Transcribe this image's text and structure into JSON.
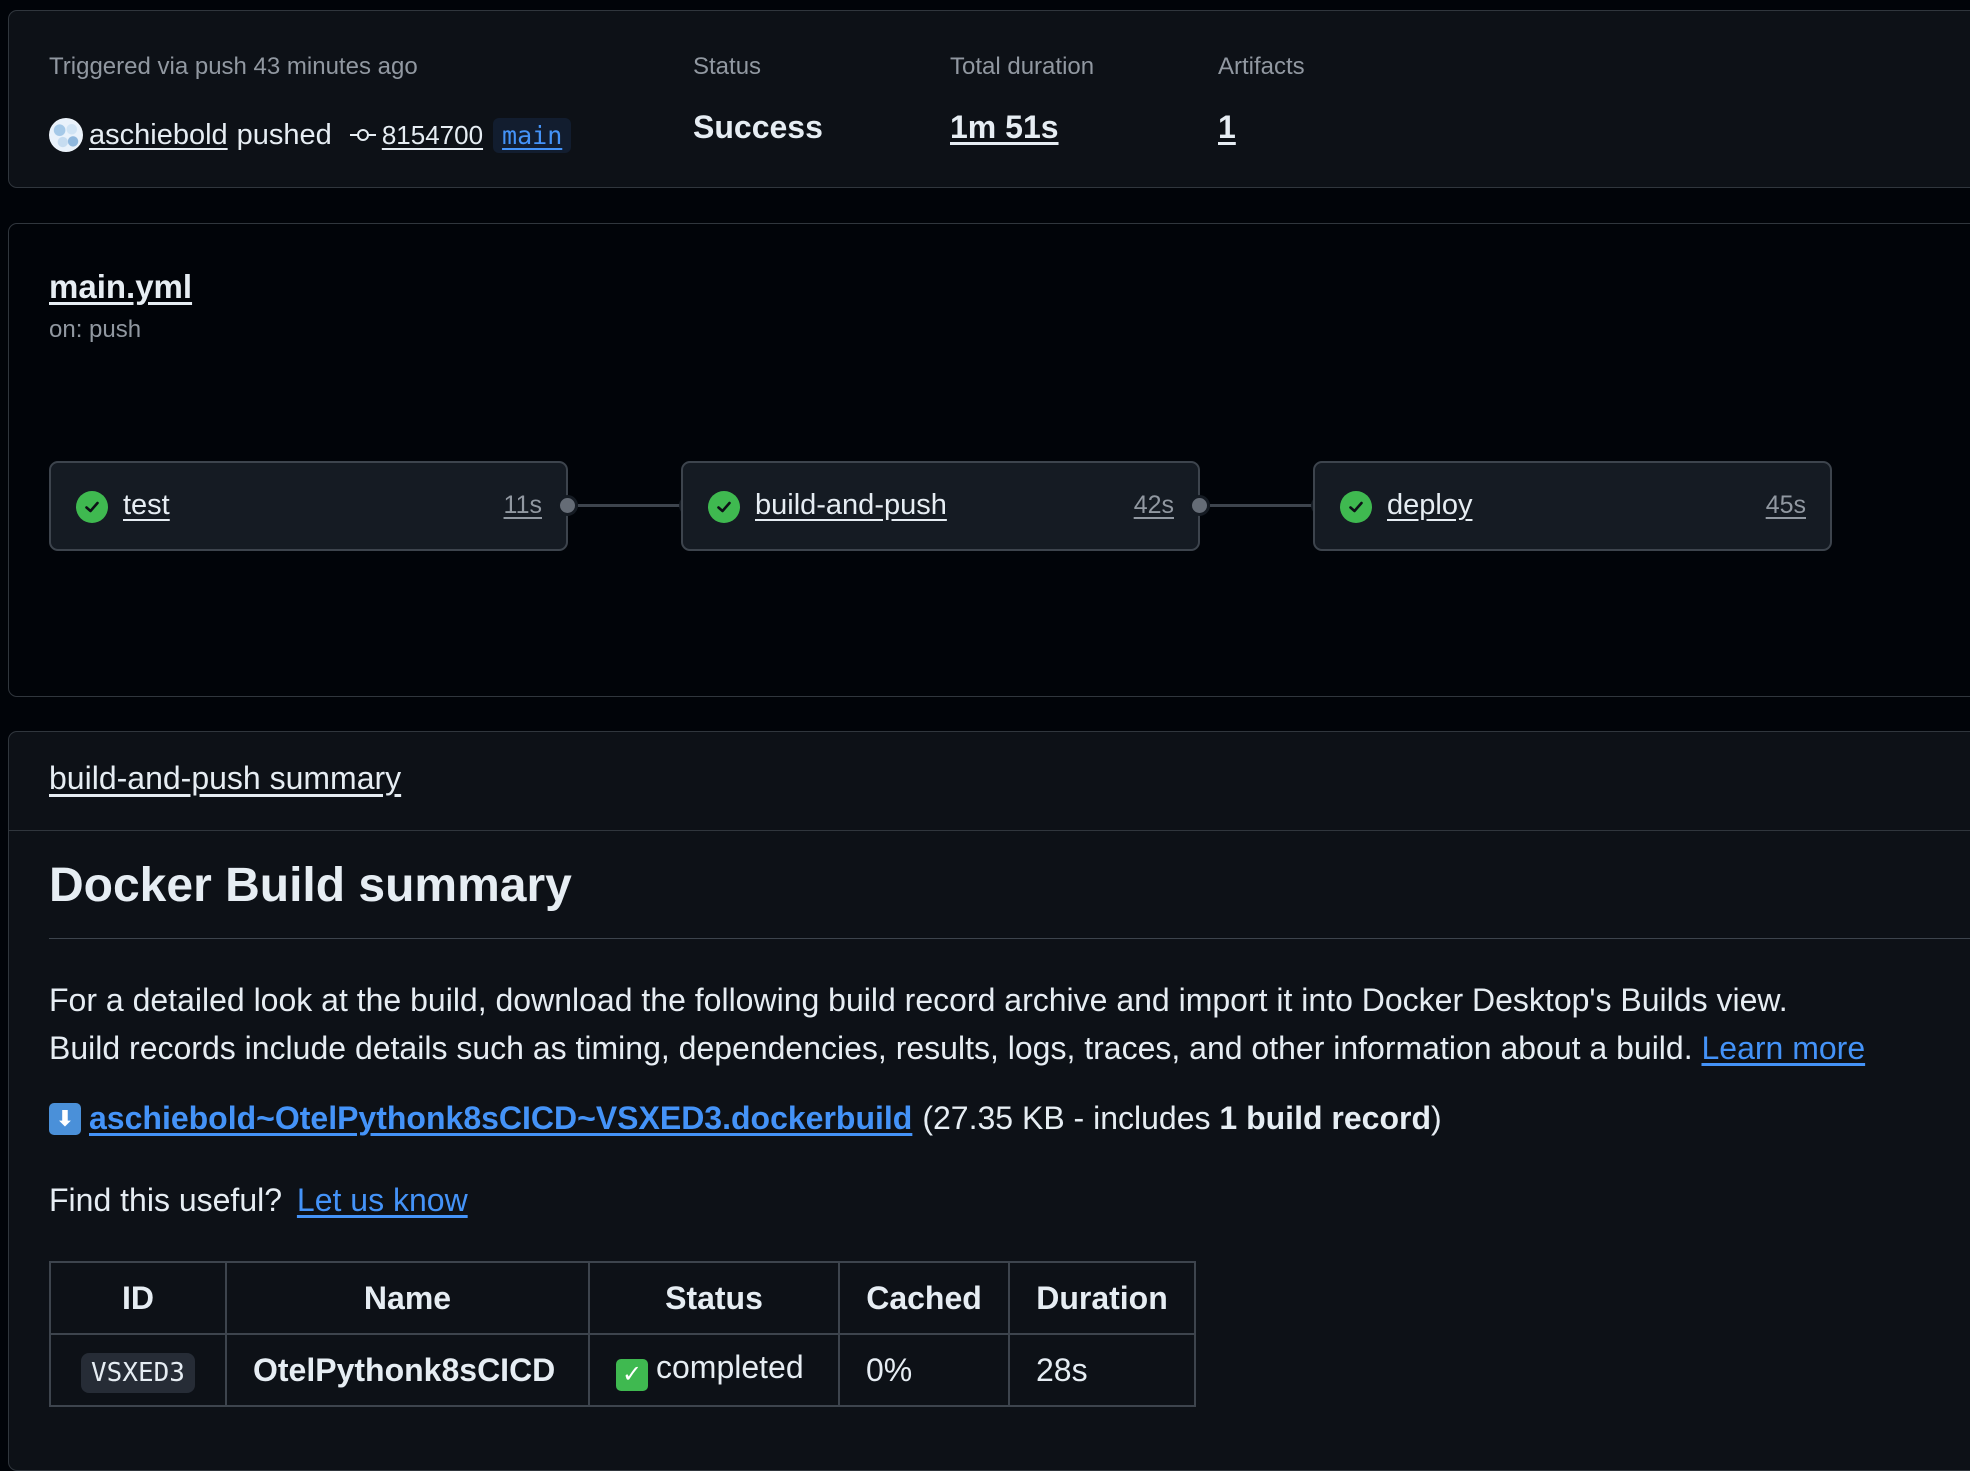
{
  "run": {
    "trigger_text": "Triggered via push 43 minutes ago",
    "actor": "aschiebold",
    "action": "pushed",
    "commit": "8154700",
    "branch": "main",
    "status_label": "Status",
    "status_value": "Success",
    "duration_label": "Total duration",
    "duration_value": "1m 51s",
    "artifacts_label": "Artifacts",
    "artifacts_value": "1"
  },
  "workflow": {
    "file": "main.yml",
    "trigger": "on: push",
    "jobs": [
      {
        "name": "test",
        "duration": "11s",
        "status": "success"
      },
      {
        "name": "build-and-push",
        "duration": "42s",
        "status": "success"
      },
      {
        "name": "deploy",
        "duration": "45s",
        "status": "success"
      }
    ]
  },
  "job_summary": {
    "header": "build-and-push summary",
    "heading": "Docker Build summary",
    "para1_line1": "For a detailed look at the build, download the following build record archive and import it into Docker Desktop's Builds view.",
    "para1_line2": "Build records include details such as timing, dependencies, results, logs, traces, and other information about a build.",
    "learn_more": "Learn more",
    "download_link": "aschiebold~OtelPythonk8sCICD~VSXED3.dockerbuild",
    "download_meta_pre": "(27.35 KB - includes ",
    "download_meta_bold": "1 build record",
    "download_meta_post": ")",
    "find_useful": "Find this useful?",
    "let_us_know": "Let us know",
    "table": {
      "headers": [
        "ID",
        "Name",
        "Status",
        "Cached",
        "Duration"
      ],
      "rows": [
        {
          "id": "VSXED3",
          "name": "OtelPythonk8sCICD",
          "status": "completed",
          "cached": "0%",
          "duration": "28s"
        }
      ]
    }
  },
  "colors": {
    "background": "#010409",
    "card": "#0d1117",
    "border": "#30363d",
    "success": "#3fb950",
    "link": "#4493f8"
  }
}
